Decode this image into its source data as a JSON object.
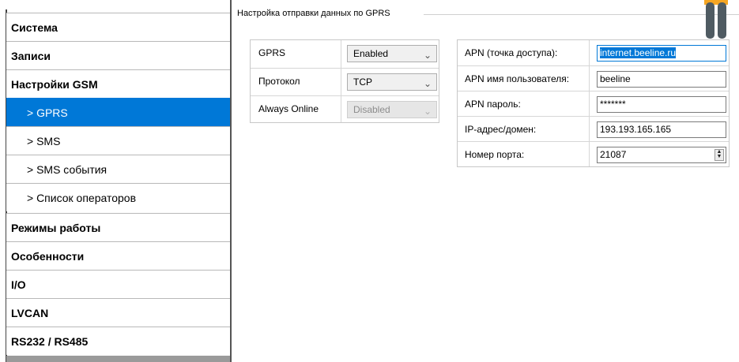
{
  "sidebar": {
    "items": [
      {
        "label": "Система",
        "kind": "group"
      },
      {
        "label": "Записи",
        "kind": "group"
      },
      {
        "label": "Настройки GSM",
        "kind": "group"
      },
      {
        "label": "> GPRS",
        "kind": "sub",
        "selected": true
      },
      {
        "label": "> SMS",
        "kind": "sub"
      },
      {
        "label": "> SMS события",
        "kind": "sub"
      },
      {
        "label": "> Список операторов",
        "kind": "sub"
      },
      {
        "label": "Режимы работы",
        "kind": "group"
      },
      {
        "label": "Особенности",
        "kind": "group"
      },
      {
        "label": "I/O",
        "kind": "group"
      },
      {
        "label": "LVCAN",
        "kind": "group"
      },
      {
        "label": "RS232 / RS485",
        "kind": "group"
      }
    ],
    "selected_color": "#0078d7"
  },
  "groupbox": {
    "title": "Настройка отправки данных по GPRS"
  },
  "gprs": {
    "rows": [
      {
        "label": "GPRS",
        "value": "Enabled",
        "disabled": false
      },
      {
        "label": "Протокол",
        "value": "TCP",
        "disabled": false
      },
      {
        "label": "Always Online",
        "value": "Disabled",
        "disabled": true
      }
    ]
  },
  "apn": {
    "rows": [
      {
        "label": "APN (точка доступа):",
        "value": "internet.beeline.ru",
        "focused": true
      },
      {
        "label": "APN имя пользователя:",
        "value": "beeline"
      },
      {
        "label": "APN пароль:",
        "value": "*******"
      },
      {
        "label": "IP-адрес/домен:",
        "value": "193.193.165.165"
      },
      {
        "label": "Номер порта:",
        "value": "21087",
        "spinner": true
      }
    ]
  },
  "icons": {
    "combo_arrow": "chevron-down-icon",
    "spinner": "spinner-icon",
    "top_right": "pause-icon"
  }
}
